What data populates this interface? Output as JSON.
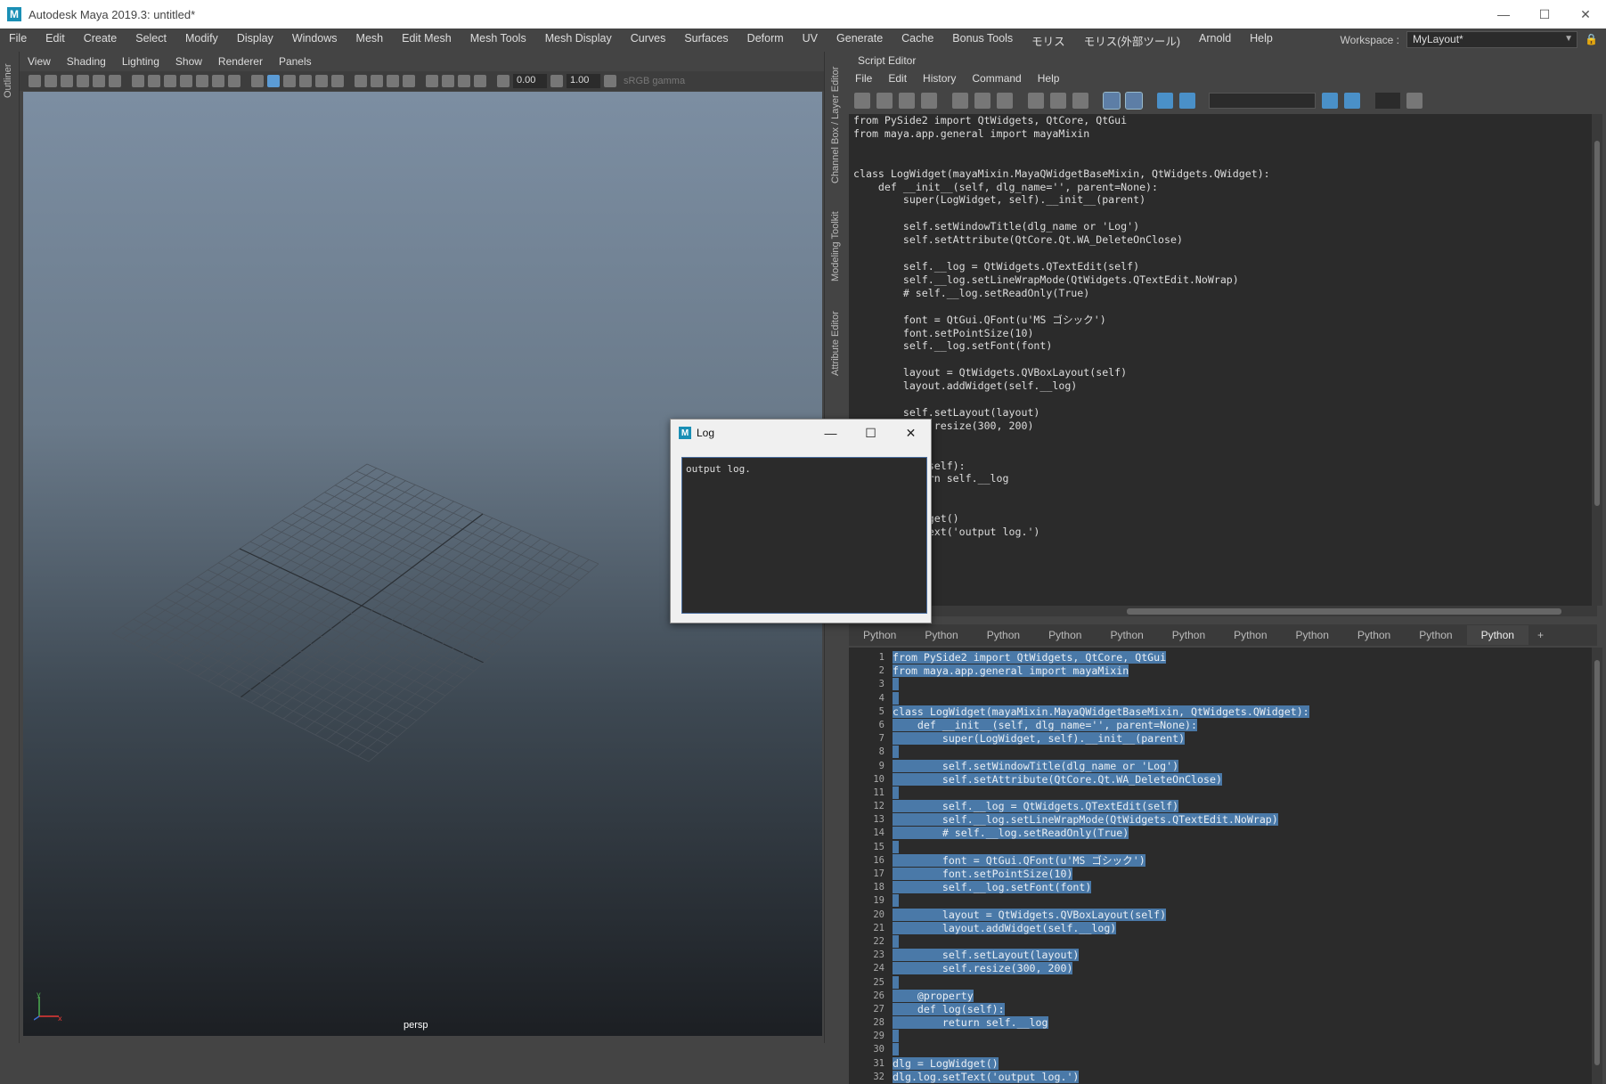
{
  "window": {
    "title": "Autodesk Maya 2019.3: untitled*",
    "logo": "M"
  },
  "menubar": {
    "items": [
      "File",
      "Edit",
      "Create",
      "Select",
      "Modify",
      "Display",
      "Windows",
      "Mesh",
      "Edit Mesh",
      "Mesh Tools",
      "Mesh Display",
      "Curves",
      "Surfaces",
      "Deform",
      "UV",
      "Generate",
      "Cache",
      "Bonus Tools",
      "モリス",
      "モリス(外部ツール)",
      "Arnold",
      "Help"
    ]
  },
  "workspace": {
    "label": "Workspace :",
    "value": "MyLayout*"
  },
  "left_strip": {
    "label": "Outliner"
  },
  "viewport": {
    "menu": [
      "View",
      "Shading",
      "Lighting",
      "Show",
      "Renderer",
      "Panels"
    ],
    "field1": "0.00",
    "field2": "1.00",
    "colorspace": "sRGB gamma",
    "camera": "persp"
  },
  "side_tabs": {
    "channel": "Channel Box / Layer Editor",
    "modeling": "Modeling Toolkit",
    "attribute": "Attribute Editor"
  },
  "script_editor": {
    "title": "Script Editor",
    "menu": [
      "File",
      "Edit",
      "History",
      "Command",
      "Help"
    ],
    "history": [
      "from PySide2 import QtWidgets, QtCore, QtGui",
      "from maya.app.general import mayaMixin",
      "",
      "",
      "class LogWidget(mayaMixin.MayaQWidgetBaseMixin, QtWidgets.QWidget):",
      "    def __init__(self, dlg_name='', parent=None):",
      "        super(LogWidget, self).__init__(parent)",
      "",
      "        self.setWindowTitle(dlg_name or 'Log')",
      "        self.setAttribute(QtCore.Qt.WA_DeleteOnClose)",
      "",
      "        self.__log = QtWidgets.QTextEdit(self)",
      "        self.__log.setLineWrapMode(QtWidgets.QTextEdit.NoWrap)",
      "        # self.__log.setReadOnly(True)",
      "",
      "        font = QtGui.QFont(u'MS ゴシック')",
      "        font.setPointSize(10)",
      "        self.__log.setFont(font)",
      "",
      "        layout = QtWidgets.QVBoxLayout(self)",
      "        layout.addWidget(self.__log)",
      "",
      "        self.setLayout(layout)",
      "        self.resize(300, 200)",
      "",
      "",
      "    def log(self):",
      "        return self.__log",
      "",
      "",
      "dlg = LogWidget()",
      "dlg.log.setText('output log.')"
    ],
    "tabs": [
      "Python",
      "Python",
      "Python",
      "Python",
      "Python",
      "Python",
      "Python",
      "Python",
      "Python",
      "Python",
      "Python",
      "+"
    ],
    "active_tab_index": 10,
    "editor_lines": [
      {
        "n": "1",
        "t": "from PySide2 import QtWidgets, QtCore, QtGui"
      },
      {
        "n": "2",
        "t": "from maya.app.general import mayaMixin"
      },
      {
        "n": "3",
        "t": ""
      },
      {
        "n": "4",
        "t": ""
      },
      {
        "n": "5",
        "t": "class LogWidget(mayaMixin.MayaQWidgetBaseMixin, QtWidgets.QWidget):"
      },
      {
        "n": "6",
        "t": "    def __init__(self, dlg_name='', parent=None):"
      },
      {
        "n": "7",
        "t": "        super(LogWidget, self).__init__(parent)"
      },
      {
        "n": "8",
        "t": ""
      },
      {
        "n": "9",
        "t": "        self.setWindowTitle(dlg_name or 'Log')"
      },
      {
        "n": "10",
        "t": "        self.setAttribute(QtCore.Qt.WA_DeleteOnClose)"
      },
      {
        "n": "11",
        "t": ""
      },
      {
        "n": "12",
        "t": "        self.__log = QtWidgets.QTextEdit(self)"
      },
      {
        "n": "13",
        "t": "        self.__log.setLineWrapMode(QtWidgets.QTextEdit.NoWrap)"
      },
      {
        "n": "14",
        "t": "        # self.__log.setReadOnly(True)"
      },
      {
        "n": "15",
        "t": ""
      },
      {
        "n": "16",
        "t": "        font = QtGui.QFont(u'MS ゴシック')"
      },
      {
        "n": "17",
        "t": "        font.setPointSize(10)"
      },
      {
        "n": "18",
        "t": "        self.__log.setFont(font)"
      },
      {
        "n": "19",
        "t": ""
      },
      {
        "n": "20",
        "t": "        layout = QtWidgets.QVBoxLayout(self)"
      },
      {
        "n": "21",
        "t": "        layout.addWidget(self.__log)"
      },
      {
        "n": "22",
        "t": ""
      },
      {
        "n": "23",
        "t": "        self.setLayout(layout)"
      },
      {
        "n": "24",
        "t": "        self.resize(300, 200)"
      },
      {
        "n": "25",
        "t": ""
      },
      {
        "n": "26",
        "t": "    @property"
      },
      {
        "n": "27",
        "t": "    def log(self):"
      },
      {
        "n": "28",
        "t": "        return self.__log"
      },
      {
        "n": "29",
        "t": ""
      },
      {
        "n": "30",
        "t": ""
      },
      {
        "n": "31",
        "t": "dlg = LogWidget()"
      },
      {
        "n": "32",
        "t": "dlg.log.setText('output log.')"
      }
    ]
  },
  "log_window": {
    "title": "Log",
    "text": "output log."
  }
}
